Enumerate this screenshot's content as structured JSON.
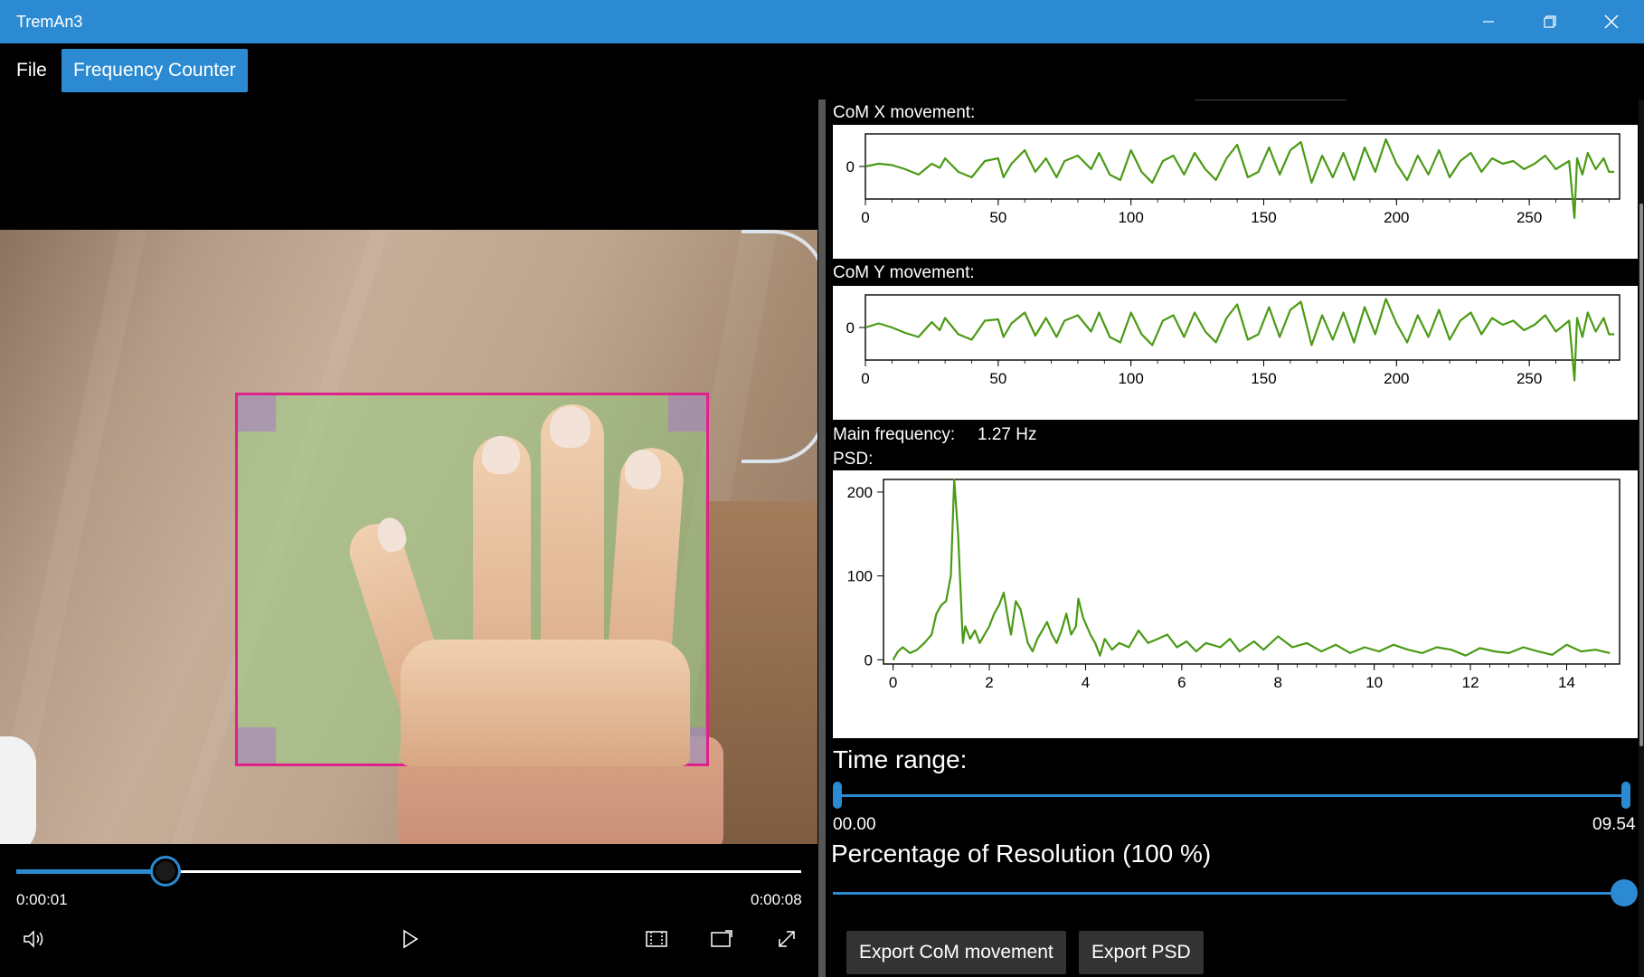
{
  "window": {
    "title": "TremAn3"
  },
  "menu": {
    "file": "File",
    "frequency_counter": "Frequency Counter"
  },
  "player": {
    "current_time": "0:00:01",
    "total_time": "0:00:08",
    "progress": 0.19
  },
  "charts": {
    "comx_label": "CoM X movement:",
    "comy_label": "CoM Y movement:",
    "main_freq_label": "Main frequency:",
    "main_freq_value": "1.27 Hz",
    "psd_label": "PSD:"
  },
  "chart_data": [
    {
      "type": "line",
      "title": "CoM X movement:",
      "xlabel": "",
      "ylabel": "",
      "xlim": [
        0,
        284
      ],
      "ylim": [
        -1.2,
        1.2
      ],
      "yticks": [
        "0"
      ],
      "xticks": [
        "0",
        "50",
        "100",
        "150",
        "200",
        "250"
      ],
      "series": [
        {
          "color": "#4a9a14",
          "x": [
            0,
            5,
            10,
            15,
            20,
            25,
            28,
            30,
            35,
            40,
            45,
            50,
            52,
            55,
            60,
            64,
            68,
            72,
            75,
            80,
            85,
            88,
            92,
            96,
            100,
            104,
            108,
            112,
            116,
            120,
            124,
            128,
            132,
            136,
            140,
            144,
            148,
            152,
            156,
            160,
            164,
            168,
            172,
            176,
            180,
            184,
            188,
            192,
            196,
            200,
            204,
            208,
            212,
            216,
            220,
            224,
            228,
            232,
            236,
            240,
            244,
            248,
            252,
            256,
            260,
            265,
            267,
            268,
            270,
            272,
            275,
            278,
            280,
            282
          ],
          "y": [
            0,
            0.1,
            0.05,
            -0.1,
            -0.3,
            0.1,
            -0.05,
            0.3,
            -0.2,
            -0.4,
            0.2,
            0.3,
            -0.4,
            0.1,
            0.6,
            -0.2,
            0.3,
            -0.4,
            0.2,
            0.4,
            -0.1,
            0.5,
            -0.3,
            -0.5,
            0.6,
            -0.2,
            -0.6,
            0.2,
            0.4,
            -0.3,
            0.5,
            -0.1,
            -0.5,
            0.3,
            0.8,
            -0.4,
            -0.2,
            0.7,
            -0.3,
            0.6,
            0.9,
            -0.6,
            0.4,
            -0.4,
            0.5,
            -0.5,
            0.7,
            -0.2,
            1.0,
            0.1,
            -0.5,
            0.4,
            -0.3,
            0.6,
            -0.4,
            0.2,
            0.5,
            -0.2,
            0.3,
            0.1,
            0.2,
            -0.1,
            0.1,
            0.4,
            -0.1,
            0.2,
            -1.9,
            0.3,
            -0.3,
            0.5,
            -0.1,
            0.3,
            -0.2,
            -0.2
          ]
        }
      ]
    },
    {
      "type": "line",
      "title": "CoM Y movement:",
      "xlabel": "",
      "ylabel": "",
      "xlim": [
        0,
        284
      ],
      "ylim": [
        -1.2,
        1.2
      ],
      "yticks": [
        "0"
      ],
      "xticks": [
        "0",
        "50",
        "100",
        "150",
        "200",
        "250"
      ],
      "series": [
        {
          "color": "#4a9a14",
          "x": [
            0,
            5,
            10,
            15,
            20,
            25,
            28,
            30,
            35,
            40,
            45,
            50,
            52,
            55,
            60,
            64,
            68,
            72,
            75,
            80,
            85,
            88,
            92,
            96,
            100,
            104,
            108,
            112,
            116,
            120,
            124,
            128,
            132,
            136,
            140,
            144,
            148,
            152,
            156,
            160,
            164,
            168,
            172,
            176,
            180,
            184,
            188,
            192,
            196,
            200,
            204,
            208,
            212,
            216,
            220,
            224,
            228,
            232,
            236,
            240,
            244,
            248,
            252,
            256,
            260,
            265,
            267,
            268,
            270,
            272,
            275,
            278,
            280,
            282
          ],
          "y": [
            0,
            0.15,
            0.0,
            -0.2,
            -0.35,
            0.2,
            -0.1,
            0.35,
            -0.25,
            -0.45,
            0.25,
            0.3,
            -0.35,
            0.15,
            0.55,
            -0.3,
            0.35,
            -0.35,
            0.25,
            0.45,
            -0.15,
            0.55,
            -0.35,
            -0.55,
            0.55,
            -0.25,
            -0.65,
            0.25,
            0.45,
            -0.35,
            0.55,
            -0.15,
            -0.55,
            0.35,
            0.85,
            -0.45,
            -0.25,
            0.75,
            -0.35,
            0.65,
            0.95,
            -0.65,
            0.45,
            -0.45,
            0.55,
            -0.55,
            0.75,
            -0.25,
            1.05,
            0.15,
            -0.55,
            0.45,
            -0.35,
            0.65,
            -0.45,
            0.25,
            0.55,
            -0.25,
            0.35,
            0.1,
            0.25,
            -0.1,
            0.1,
            0.45,
            -0.15,
            0.25,
            -1.95,
            0.35,
            -0.35,
            0.55,
            -0.15,
            0.35,
            -0.25,
            -0.25
          ]
        }
      ]
    },
    {
      "type": "line",
      "title": "PSD:",
      "xlabel": "",
      "ylabel": "",
      "xlim": [
        -0.2,
        15.1
      ],
      "ylim": [
        -5,
        215
      ],
      "yticks": [
        0,
        100,
        200
      ],
      "xticks": [
        0,
        2,
        4,
        6,
        8,
        10,
        12,
        14
      ],
      "series": [
        {
          "color": "#4a9a14",
          "x": [
            0,
            0.1,
            0.2,
            0.35,
            0.5,
            0.65,
            0.8,
            0.9,
            1.0,
            1.1,
            1.2,
            1.27,
            1.35,
            1.45,
            1.5,
            1.6,
            1.7,
            1.8,
            1.9,
            2.0,
            2.1,
            2.2,
            2.3,
            2.4,
            2.45,
            2.55,
            2.65,
            2.8,
            2.9,
            3.0,
            3.1,
            3.2,
            3.3,
            3.4,
            3.5,
            3.6,
            3.7,
            3.8,
            3.85,
            3.95,
            4.1,
            4.2,
            4.3,
            4.4,
            4.55,
            4.7,
            4.9,
            5.1,
            5.3,
            5.5,
            5.7,
            5.9,
            6.1,
            6.3,
            6.5,
            6.8,
            7.0,
            7.2,
            7.5,
            7.7,
            8.0,
            8.3,
            8.6,
            8.9,
            9.2,
            9.5,
            9.8,
            10.1,
            10.4,
            10.7,
            11.0,
            11.3,
            11.6,
            11.9,
            12.2,
            12.5,
            12.8,
            13.1,
            13.4,
            13.7,
            14.0,
            14.3,
            14.6,
            14.9
          ],
          "y": [
            0,
            10,
            15,
            8,
            12,
            20,
            30,
            55,
            65,
            70,
            100,
            215,
            150,
            20,
            40,
            25,
            35,
            20,
            30,
            40,
            55,
            65,
            80,
            45,
            30,
            70,
            60,
            20,
            10,
            25,
            35,
            45,
            30,
            20,
            35,
            55,
            30,
            40,
            73,
            50,
            30,
            20,
            5,
            25,
            12,
            20,
            15,
            35,
            20,
            25,
            30,
            15,
            22,
            10,
            20,
            15,
            25,
            10,
            22,
            12,
            28,
            15,
            20,
            10,
            18,
            8,
            15,
            10,
            18,
            12,
            8,
            15,
            12,
            5,
            14,
            10,
            8,
            15,
            10,
            6,
            18,
            10,
            12,
            8
          ]
        }
      ]
    }
  ],
  "controls": {
    "time_range_label": "Time range:",
    "time_range_start": "00.00",
    "time_range_end": "09.54",
    "resolution_label": "Percentage of Resolution (100 %)",
    "resolution_value": 100,
    "export_com": "Export CoM movement",
    "export_psd": "Export PSD"
  }
}
